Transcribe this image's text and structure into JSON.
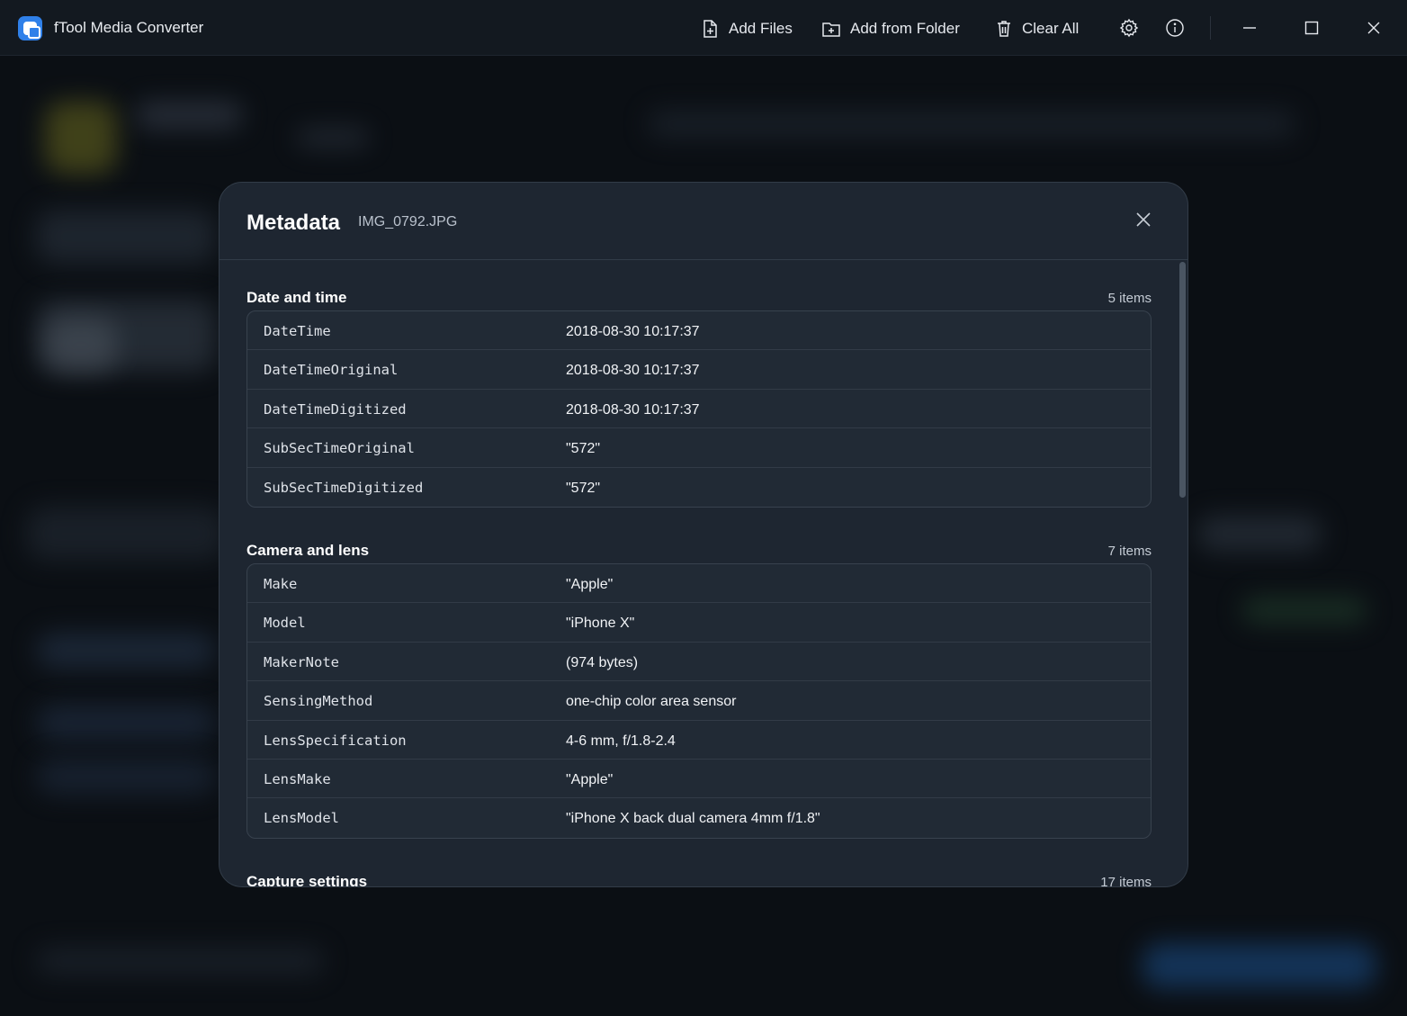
{
  "app": {
    "title": "fTool Media Converter"
  },
  "toolbar": {
    "add_files": "Add Files",
    "add_from_folder": "Add from Folder",
    "clear_all": "Clear All"
  },
  "modal": {
    "title": "Metadata",
    "filename": "IMG_0792.JPG",
    "sections": [
      {
        "title": "Date and time",
        "count": "5 items",
        "rows": [
          {
            "key": "DateTime",
            "value": "2018-08-30 10:17:37"
          },
          {
            "key": "DateTimeOriginal",
            "value": "2018-08-30 10:17:37"
          },
          {
            "key": "DateTimeDigitized",
            "value": "2018-08-30 10:17:37"
          },
          {
            "key": "SubSecTimeOriginal",
            "value": "\"572\""
          },
          {
            "key": "SubSecTimeDigitized",
            "value": "\"572\""
          }
        ]
      },
      {
        "title": "Camera and lens",
        "count": "7 items",
        "rows": [
          {
            "key": "Make",
            "value": "\"Apple\""
          },
          {
            "key": "Model",
            "value": "\"iPhone X\""
          },
          {
            "key": "MakerNote",
            "value": "(974 bytes)"
          },
          {
            "key": "SensingMethod",
            "value": "one-chip color area sensor"
          },
          {
            "key": "LensSpecification",
            "value": "4-6 mm, f/1.8-2.4"
          },
          {
            "key": "LensMake",
            "value": "\"Apple\""
          },
          {
            "key": "LensModel",
            "value": "\"iPhone X back dual camera 4mm f/1.8\""
          }
        ]
      },
      {
        "title": "Capture settings",
        "count": "17 items",
        "rows": []
      }
    ]
  },
  "colors": {
    "accent": "#2f80e9",
    "modal_bg": "#1e2631",
    "titlebar_bg": "#131920"
  }
}
